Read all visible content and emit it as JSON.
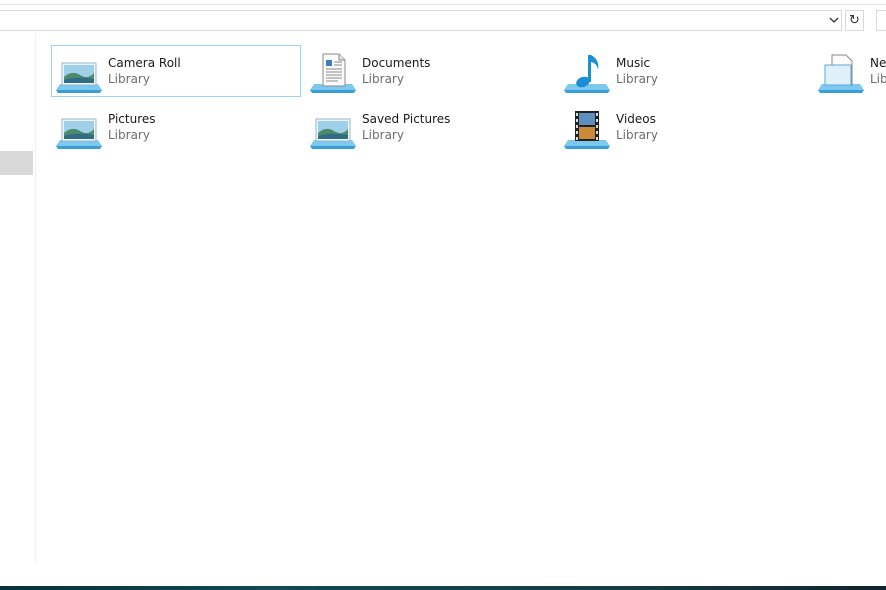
{
  "address_bar": {
    "value": ""
  },
  "libraries": [
    {
      "name": "Camera Roll",
      "type": "Library",
      "icon": "pictures-library-icon"
    },
    {
      "name": "Documents",
      "type": "Library",
      "icon": "documents-library-icon"
    },
    {
      "name": "Music",
      "type": "Library",
      "icon": "music-library-icon"
    },
    {
      "name": "Ne",
      "type": "Lib",
      "icon": "new-library-icon"
    },
    {
      "name": "Pictures",
      "type": "Library",
      "icon": "pictures-library-icon"
    },
    {
      "name": "Saved Pictures",
      "type": "Library",
      "icon": "pictures-library-icon"
    },
    {
      "name": "Videos",
      "type": "Library",
      "icon": "videos-library-icon"
    }
  ],
  "colors": {
    "selection_border": "#99d1ff",
    "accent_blue": "#1a8fd6",
    "taskbar": "#0e4a55"
  }
}
